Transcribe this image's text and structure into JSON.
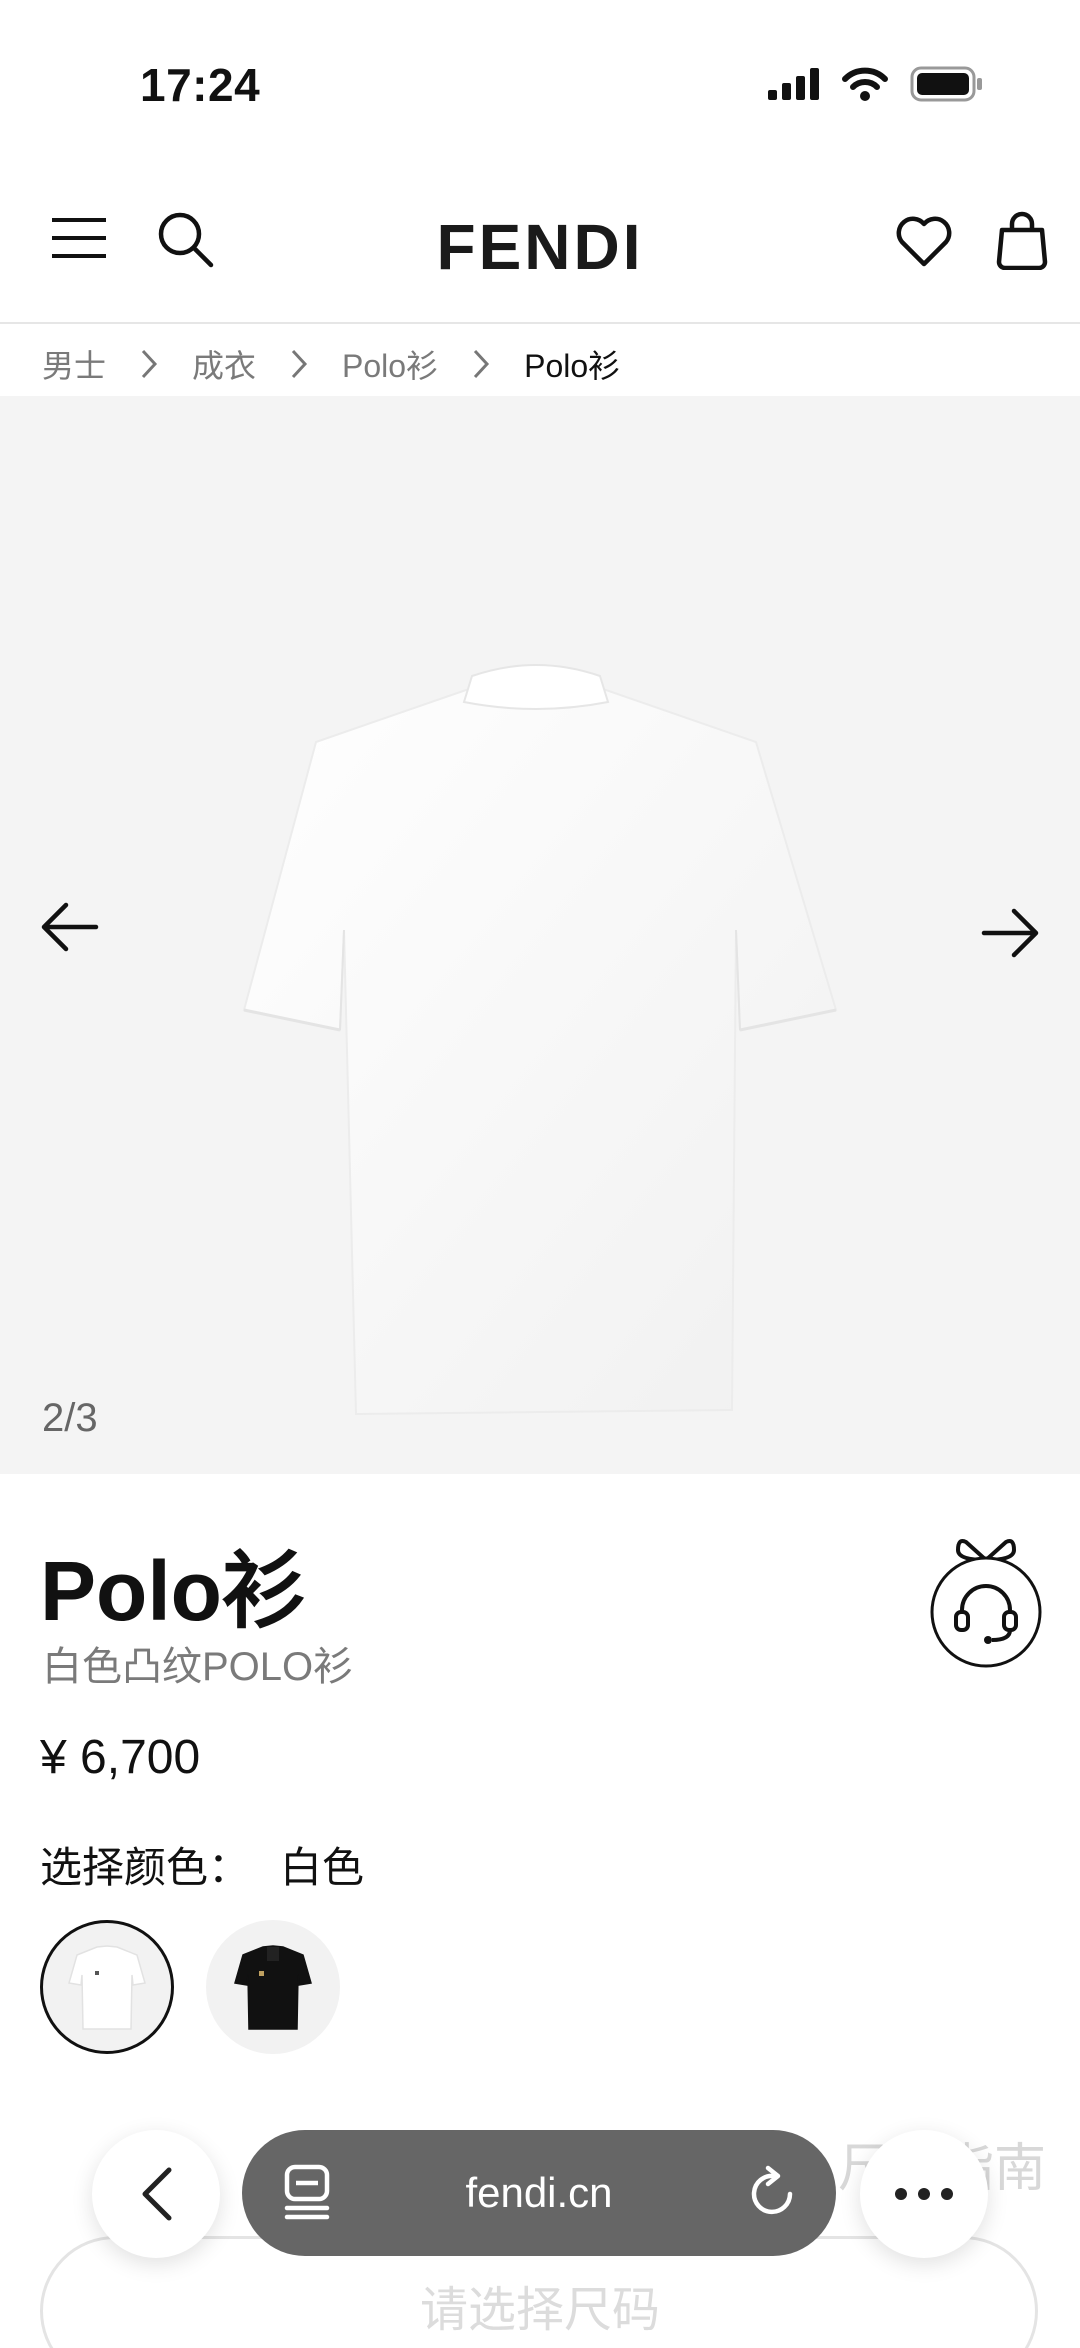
{
  "status_bar": {
    "time": "17:24",
    "icons": [
      "signal-icon",
      "wifi-icon",
      "battery-icon"
    ]
  },
  "header": {
    "brand": "FENDI",
    "icons": [
      "menu-icon",
      "search-icon",
      "heart-icon",
      "bag-icon"
    ]
  },
  "breadcrumb": {
    "items": [
      "男士",
      "成衣",
      "Polo衫",
      "Polo衫"
    ]
  },
  "gallery": {
    "counter": "2/3",
    "background": "#f4f4f4"
  },
  "product": {
    "title": "Polo衫",
    "subtitle": "白色凸纹POLO衫",
    "price": "¥ 6,700",
    "color_label": "选择颜色：",
    "color_value": "白色",
    "swatches": [
      {
        "color": "white",
        "selected": true
      },
      {
        "color": "black",
        "selected": false
      }
    ]
  },
  "faded": {
    "size_guide": "尺码指南",
    "size_select_placeholder": "请选择尺码"
  },
  "browser": {
    "url": "fendi.cn",
    "url_bar_color": "#666666"
  }
}
